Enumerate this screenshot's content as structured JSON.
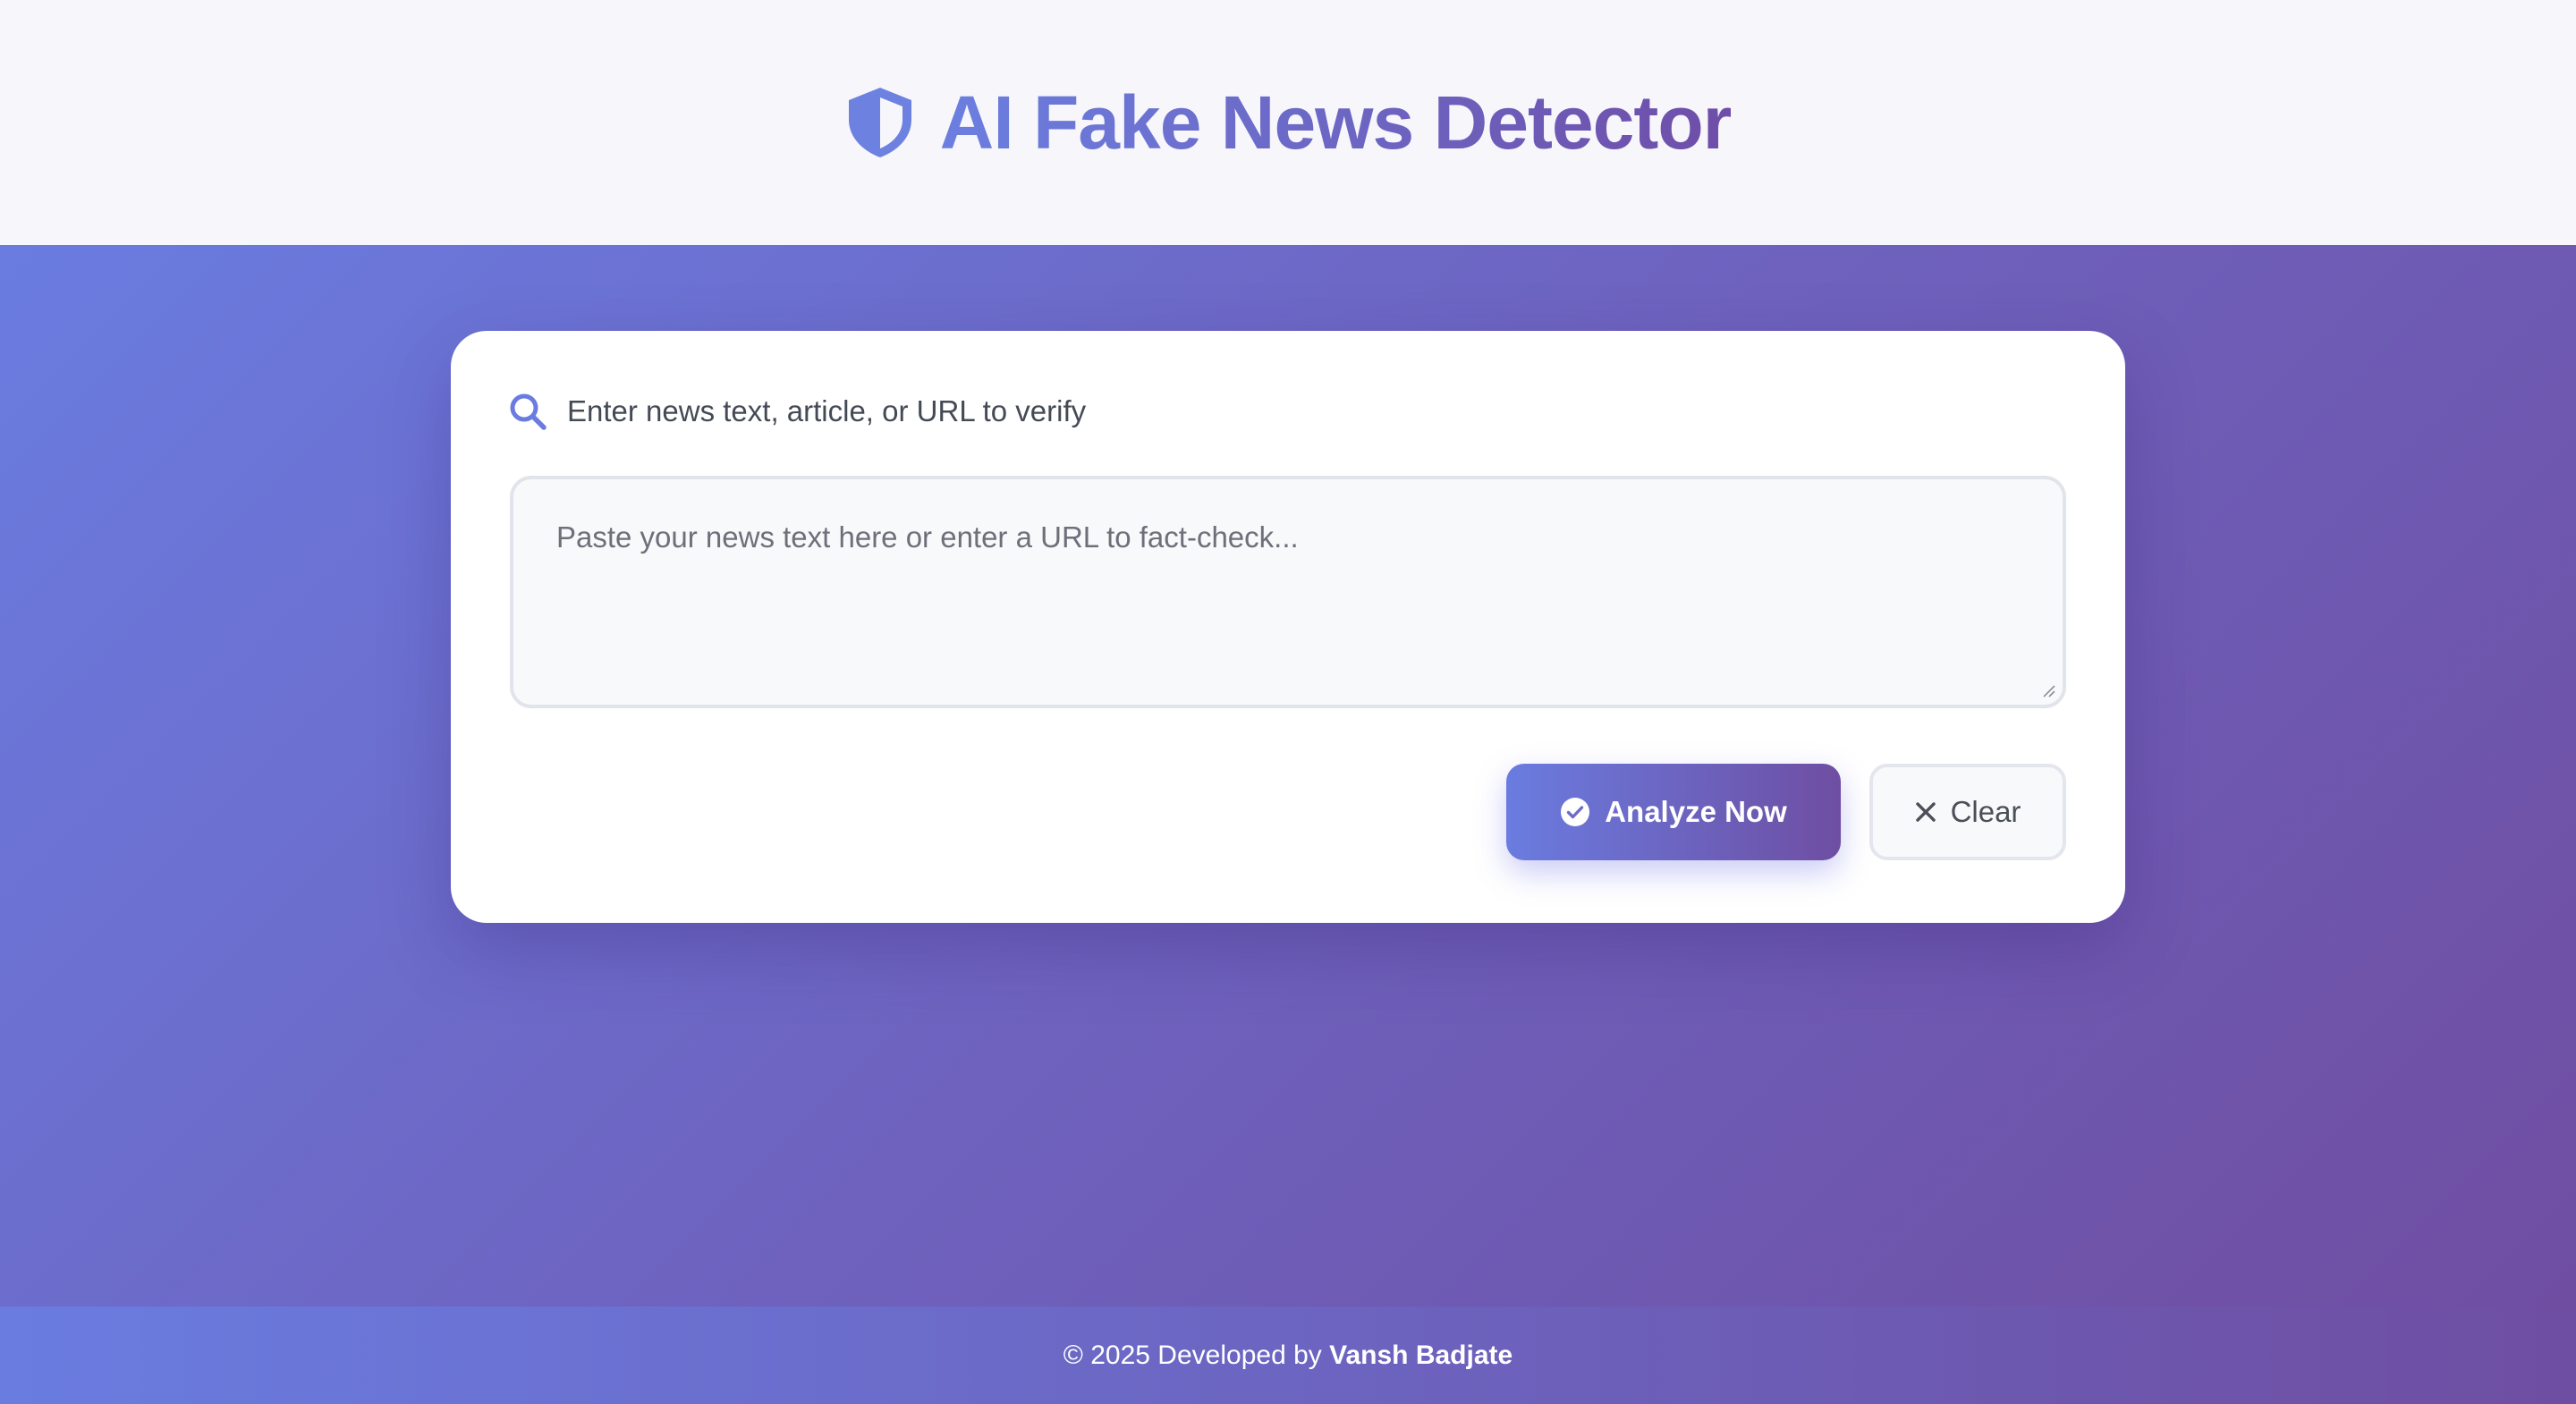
{
  "header": {
    "title": "AI Fake News Detector",
    "icon": "shield-icon"
  },
  "card": {
    "label": "Enter news text, article, or URL to verify",
    "label_icon": "search-icon",
    "input_placeholder": "Paste your news text here or enter a URL to fact-check...",
    "input_value": ""
  },
  "actions": {
    "analyze_label": "Analyze Now",
    "analyze_icon": "check-circle-icon",
    "clear_label": "Clear",
    "clear_icon": "close-icon"
  },
  "footer": {
    "prefix": "© 2025 Developed by",
    "author": "Vansh Badjate"
  },
  "colors": {
    "accent_start": "#6a7ce0",
    "accent_end": "#6e4ea2",
    "card_bg": "#ffffff",
    "header_bg": "#f7f6fb"
  }
}
